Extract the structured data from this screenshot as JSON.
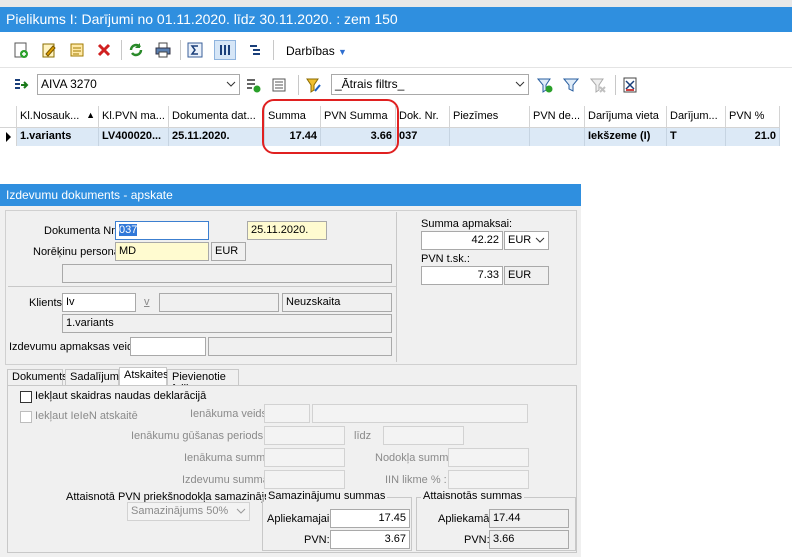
{
  "window1": {
    "title": "Pielikums I: Darījumi no 01.11.2020. līdz 30.11.2020. : zem 150",
    "menu_label": "Darbības",
    "company_select": "AIVA 3270",
    "filter_select": "_Ātrais filtrs_",
    "columns": [
      "Kl.Nosauk...",
      "Kl.PVN ma...",
      "Dokumenta dat...",
      "Summa",
      "PVN Summa",
      "Dok. Nr.",
      "Piezīmes",
      "PVN de...",
      "Darījuma vieta",
      "Darījum...",
      "PVN %"
    ],
    "row": [
      "1.variants",
      "LV400020...",
      "25.11.2020.",
      "17.44",
      "3.66",
      "037",
      "",
      "",
      "Iekšzeme (I)",
      "T",
      "21.0"
    ]
  },
  "window2": {
    "title": "Izdevumu dokuments - apskate",
    "doc_nr_label": "Dokumenta Nr.:",
    "doc_nr_value": "037",
    "doc_date": "25.11.2020.",
    "person_label": "Norēķinu persona:",
    "person_value": "MD",
    "currency": "EUR",
    "sum_label": "Summa apmaksai:",
    "sum_value": "42.22",
    "sum_currency": "EUR",
    "vat_label": "PVN t.sk.:",
    "vat_value": "7.33",
    "vat_currency": "EUR",
    "client_label": "Klients:",
    "client_value": "Iv",
    "client_extra": "v",
    "client_type": "Neuzskaita",
    "client_name": "1.variants",
    "payment_label": "Izdevumu apmaksas veids:",
    "tabs": [
      "Dokuments",
      "Sadalījums",
      "Atskaites",
      "Pievienotie faili"
    ],
    "check1": "Iekļaut skaidras naudas deklarācijā",
    "check2": "Iekļaut IeIeN atskaitē",
    "income_type_label": "Ienākuma veids:",
    "income_period_label": "Ienākumu gūšanas periods:",
    "till_label": "līdz",
    "income_sum_label": "Ienākuma summa:",
    "tax_sum_label": "Nodokļa summa:",
    "expense_sum_label": "Izdevumu summa:",
    "iin_rate_label": "IIN likme % :",
    "vat_reduction_label": "Attaisnotā PVN priekšnodokļa samazinājumi:",
    "vat_reduction_value": "Samazinājums 50%",
    "reduction_group": "Samazinājumu summas",
    "base_label": "Apliekamajai:",
    "base_value": "17.45",
    "pvn_label": "PVN:",
    "pvn_value": "3.67",
    "justified_group": "Attaisnotās summas",
    "taxable_label": "Apliekamā:",
    "taxable_value": "17.44",
    "pvn2_label": "PVN:",
    "pvn2_value": "3.66"
  },
  "colors": {
    "titlebar": "#2f8fdf",
    "highlight": "#e02020",
    "selected_row": "#dce9f6"
  }
}
